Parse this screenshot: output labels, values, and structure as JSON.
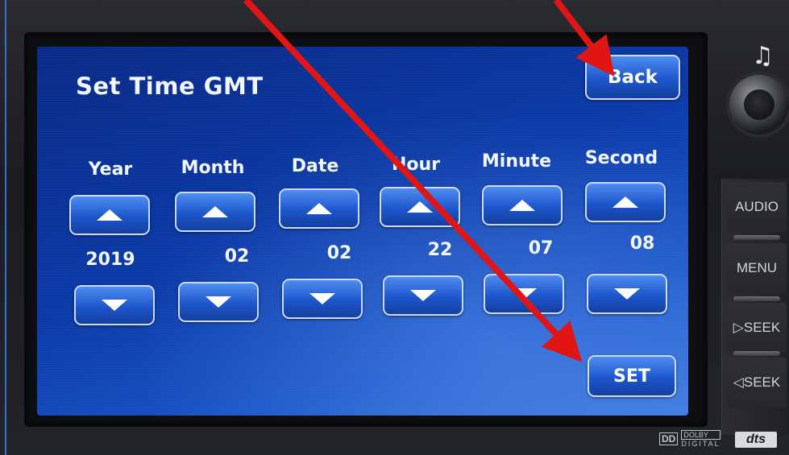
{
  "screen": {
    "title": "Set Time GMT",
    "back_label": "Back",
    "set_label": "SET",
    "columns": [
      {
        "label": "Year",
        "value": "2019"
      },
      {
        "label": "Month",
        "value": "02"
      },
      {
        "label": "Date",
        "value": "02"
      },
      {
        "label": "Hour",
        "value": "22"
      },
      {
        "label": "Minute",
        "value": "07"
      },
      {
        "label": "Second",
        "value": "08"
      }
    ]
  },
  "hardware": {
    "buttons": [
      "AUDIO",
      "MENU",
      "▷SEEK",
      "◁SEEK"
    ],
    "note_icon": "music-note-icon",
    "dolby_text": "DOLBY",
    "dolby_sub": "DIGITAL",
    "dts_text": "dts"
  },
  "colors": {
    "screen_blue": "#0b3aa8",
    "button_border": "#c9dcff",
    "annotation_arrow": "#e01515"
  },
  "annotations": {
    "arrow_count": 3,
    "icon": "red-arrow-icon"
  }
}
